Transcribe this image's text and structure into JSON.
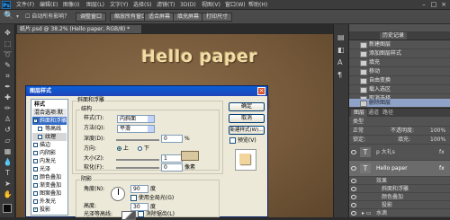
{
  "app": {
    "logo": "Ps",
    "menu": [
      "文件(F)",
      "编辑(E)",
      "图像(I)",
      "图层(L)",
      "文字(Y)",
      "选择(S)",
      "滤镜(T)",
      "3D(D)",
      "视图(V)",
      "窗口(W)",
      "帮助(H)"
    ],
    "window_controls": [
      "–",
      "□",
      "×"
    ]
  },
  "options": {
    "auto_select_label": "☐ 自动所有影响？",
    "buttons": [
      "调整窗口",
      "缩放所有窗口",
      "适合屏幕",
      "填充屏幕",
      "打印尺寸"
    ]
  },
  "document": {
    "tab_title": "纸片.psd @ 38.2% (Hello paper, RGB/8) *",
    "canvas_text": "Hello paper"
  },
  "history": {
    "tabs": [
      "历史记录"
    ],
    "items": [
      {
        "label": "新建图层",
        "selected": false
      },
      {
        "label": "添加图层样式",
        "selected": false
      },
      {
        "label": "填充",
        "selected": false
      },
      {
        "label": "移动",
        "selected": false
      },
      {
        "label": "自由变换",
        "selected": false
      },
      {
        "label": "载入选区",
        "selected": false
      },
      {
        "label": "取消选择",
        "selected": false
      },
      {
        "label": "删除图层",
        "selected": true
      }
    ]
  },
  "layers": {
    "header_tabs": [
      "图层",
      "通道",
      "路径"
    ],
    "search_label": "类型",
    "blend_mode": "正常",
    "opacity_label": "不透明度:",
    "opacity_value": "100%",
    "lock_label": "锁定:",
    "fill_label": "填充:",
    "fill_value": "100%",
    "rows": [
      {
        "name": "p 大礼s",
        "type": "text"
      },
      {
        "name": "Hello paper",
        "type": "text",
        "selected": true
      },
      {
        "name": "效果",
        "type": "effect"
      },
      {
        "name": "斜面和浮雕",
        "type": "effect"
      },
      {
        "name": "颜色叠加",
        "type": "effect"
      },
      {
        "name": "投影",
        "type": "effect"
      },
      {
        "name": "水滴",
        "type": "group"
      }
    ]
  },
  "dialog": {
    "title": "图层样式",
    "close": "×",
    "left_header": "样式",
    "left_items": [
      {
        "label": "混合选项:默认",
        "checkbox": false,
        "state": "header"
      },
      {
        "label": "斜面和浮雕",
        "checkbox": true,
        "checked": true,
        "state": "selected"
      },
      {
        "label": "等高线",
        "checkbox": true,
        "checked": false,
        "state": "normal",
        "indent": true
      },
      {
        "label": "纹理",
        "checkbox": true,
        "checked": false,
        "state": "highlight",
        "indent": true
      },
      {
        "label": "描边",
        "checkbox": true,
        "checked": false,
        "state": "normal"
      },
      {
        "label": "内阴影",
        "checkbox": true,
        "checked": false,
        "state": "normal"
      },
      {
        "label": "内发光",
        "checkbox": true,
        "checked": false,
        "state": "normal"
      },
      {
        "label": "光泽",
        "checkbox": true,
        "checked": false,
        "state": "normal"
      },
      {
        "label": "颜色叠加",
        "checkbox": true,
        "checked": true,
        "state": "normal"
      },
      {
        "label": "渐变叠加",
        "checkbox": true,
        "checked": false,
        "state": "normal"
      },
      {
        "label": "图案叠加",
        "checkbox": true,
        "checked": false,
        "state": "normal"
      },
      {
        "label": "外发光",
        "checkbox": true,
        "checked": false,
        "state": "normal"
      },
      {
        "label": "投影",
        "checkbox": true,
        "checked": true,
        "state": "normal"
      }
    ],
    "bevel": {
      "section_title": "斜面和浮雕",
      "structure_title": "结构",
      "style_label": "样式(T):",
      "style_value": "内斜面",
      "technique_label": "方法(Q):",
      "technique_value": "平滑",
      "depth_label": "深度(D):",
      "depth_value": "0",
      "depth_unit": "%",
      "direction_label": "方向:",
      "direction_up": "上",
      "direction_down": "下",
      "size_label": "大小(Z):",
      "size_value": "1",
      "size_unit": "像素",
      "soften_label": "软化(F):",
      "soften_value": "0",
      "soften_unit": "像素"
    },
    "shading": {
      "section_title": "阴影",
      "angle_label": "角度(N):",
      "angle_value": "90",
      "angle_unit": "度",
      "global_light_label": "使用全局光(G)",
      "altitude_label": "高度:",
      "altitude_value": "30",
      "altitude_unit": "度",
      "gloss_label": "光泽等高线:",
      "anti_alias_label": "消除锯齿(L)"
    },
    "buttons": {
      "ok": "确定",
      "cancel": "取消",
      "new_style": "新建样式(W)...",
      "preview_label": "预览(V)"
    }
  },
  "colors": {
    "foreground": "#0b0b0b",
    "background": "#f5f5f5",
    "preview_swatch": "#f1d59b"
  }
}
